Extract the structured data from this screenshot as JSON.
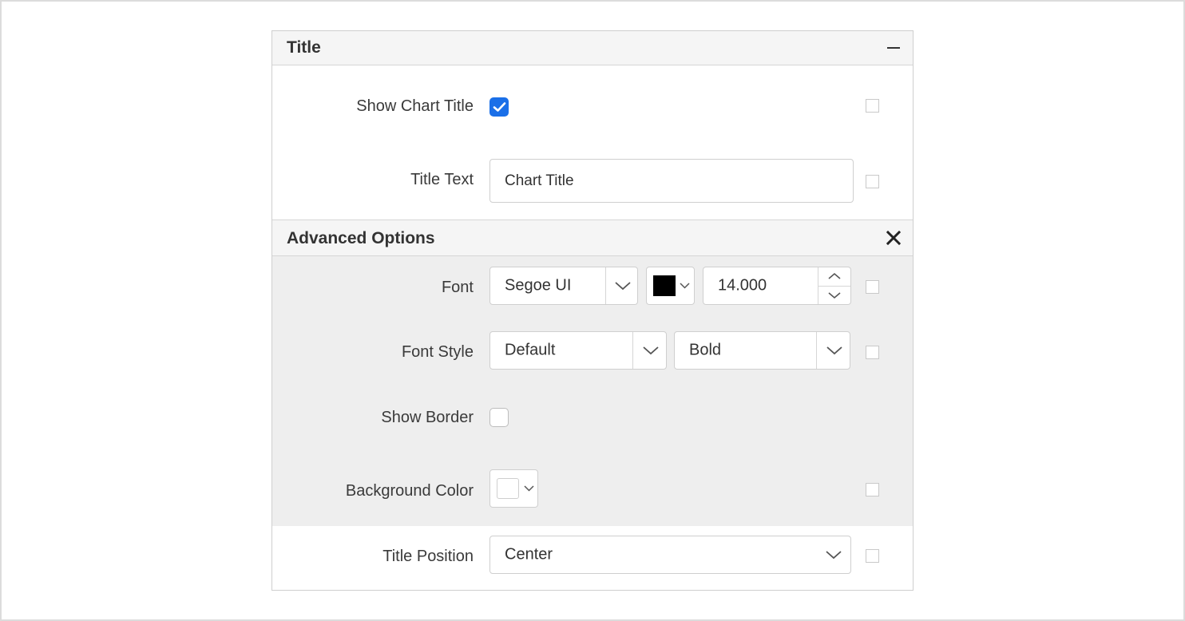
{
  "panel": {
    "title_section": {
      "header": "Title",
      "show_chart_title_label": "Show Chart Title",
      "show_chart_title_checked": true,
      "title_text_label": "Title Text",
      "title_text_value": "Chart Title"
    },
    "advanced_section": {
      "header": "Advanced Options",
      "font_label": "Font",
      "font_family_value": "Segoe UI",
      "font_color": "#000000",
      "font_size_value": "14.000",
      "font_style_label": "Font Style",
      "font_style_value": "Default",
      "font_weight_value": "Bold",
      "show_border_label": "Show Border",
      "show_border_checked": false,
      "background_color_label": "Background Color",
      "background_color": "#ffffff"
    },
    "title_position_label": "Title Position",
    "title_position_value": "Center"
  },
  "colors": {
    "accent": "#1a6fe8",
    "header_bg": "#f5f5f5",
    "advanced_bg": "#eeeeee"
  }
}
